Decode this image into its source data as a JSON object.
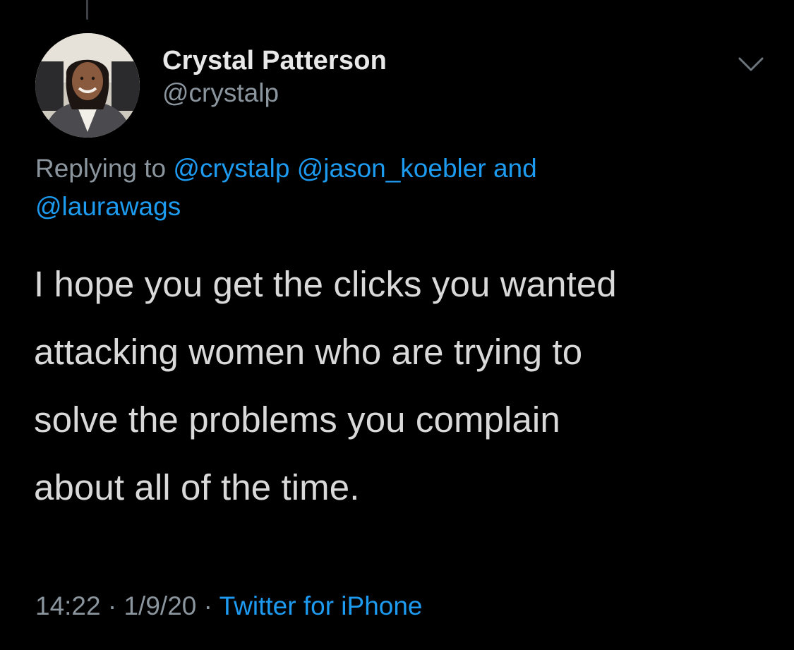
{
  "author": {
    "display_name": "Crystal Patterson",
    "handle": "@crystalp"
  },
  "reply_context": {
    "prefix": "Replying to",
    "mentions": [
      "@crystalp",
      "@jason_koebler"
    ],
    "conjunction": "and",
    "last_mention": "@laurawags"
  },
  "tweet": {
    "lines": [
      "I hope you get the clicks you wanted",
      "attacking women who are trying to",
      "solve the problems you complain",
      "about all of the time."
    ]
  },
  "meta": {
    "time": "14:22",
    "date": "1/9/20",
    "separator": "·",
    "source": "Twitter for iPhone"
  },
  "icons": {
    "menu": "chevron-down-icon"
  },
  "colors": {
    "background": "#000000",
    "text_primary": "#d9d9d9",
    "text_secondary": "#8b959e",
    "link": "#1d9bf0"
  }
}
